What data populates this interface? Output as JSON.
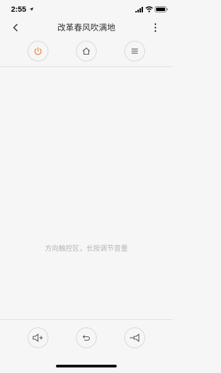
{
  "status_bar": {
    "time": "2:55",
    "icons": [
      "location-arrow-icon",
      "signal-icon",
      "wifi-icon",
      "battery-icon"
    ]
  },
  "header": {
    "title": "改革春风吹满地",
    "back_icon": "chevron-left-icon",
    "more_icon": "vertical-ellipsis-icon"
  },
  "top_controls": [
    {
      "name": "power",
      "icon": "power-icon",
      "color": "#f08a4b"
    },
    {
      "name": "home",
      "icon": "home-icon",
      "color": "#555555"
    },
    {
      "name": "menu",
      "icon": "menu-icon",
      "color": "#555555"
    }
  ],
  "touch_area": {
    "hint": "方向触控区，长按调节音量"
  },
  "bottom_controls": [
    {
      "name": "volume-up",
      "icon": "volume-up-icon"
    },
    {
      "name": "back",
      "icon": "return-icon"
    },
    {
      "name": "volume-down",
      "icon": "volume-down-icon"
    }
  ],
  "colors": {
    "background": "#f6f6f6",
    "accent": "#f08a4b",
    "icon": "#555555",
    "divider": "#e2e2e2",
    "hint_text": "#b5b5b5"
  }
}
